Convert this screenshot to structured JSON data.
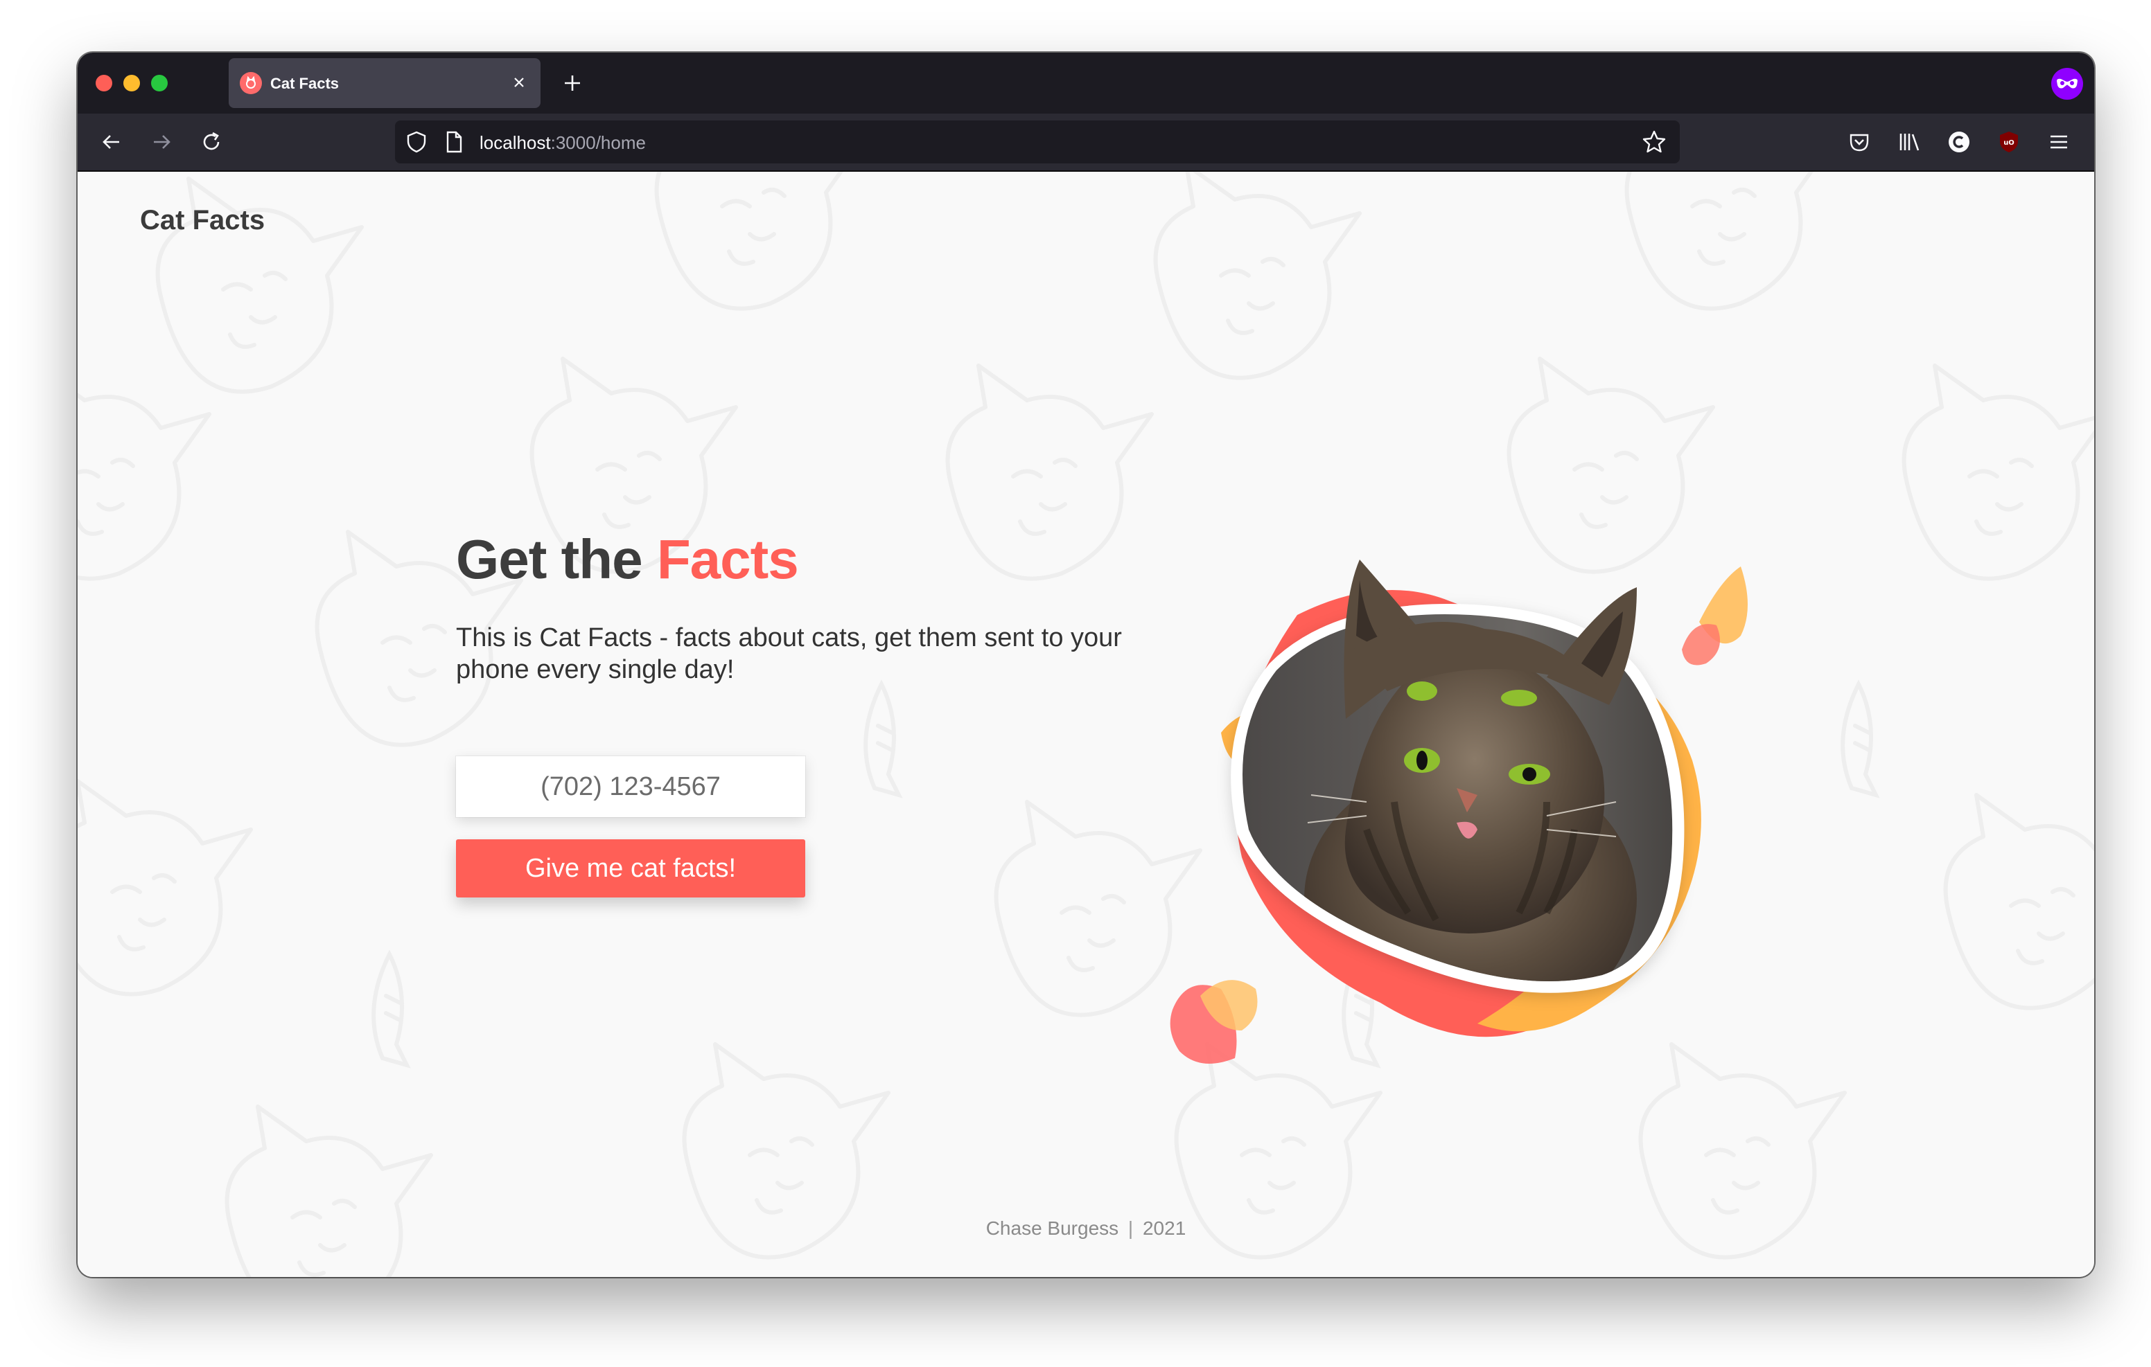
{
  "browser": {
    "tab": {
      "title": "Cat Facts"
    },
    "url": {
      "host": "localhost",
      "path": ":3000/home"
    },
    "icons": {
      "tab_favicon": "cat-favicon-icon",
      "back": "arrow-left-icon",
      "forward": "arrow-right-icon",
      "reload": "reload-icon",
      "bookmark": "star-icon",
      "pocket": "pocket-icon",
      "library": "library-icon",
      "menu": "hamburger-menu-icon"
    }
  },
  "page": {
    "brand": "Cat Facts",
    "headline": {
      "prefix": "Get the ",
      "accent": "Facts"
    },
    "subtitle": "This is Cat Facts - facts about cats, get them sent to your phone every single day!",
    "phone_input": {
      "placeholder": "(702) 123-4567",
      "value": ""
    },
    "cta_label": "Give me cat facts!",
    "footer": {
      "author": "Chase Burgess",
      "separator": "|",
      "year": "2021"
    }
  },
  "colors": {
    "accent": "#ff5f57",
    "blob_orange": "#ffb347",
    "text_dark": "#3d3d3d",
    "background": "#f9f9f9"
  }
}
